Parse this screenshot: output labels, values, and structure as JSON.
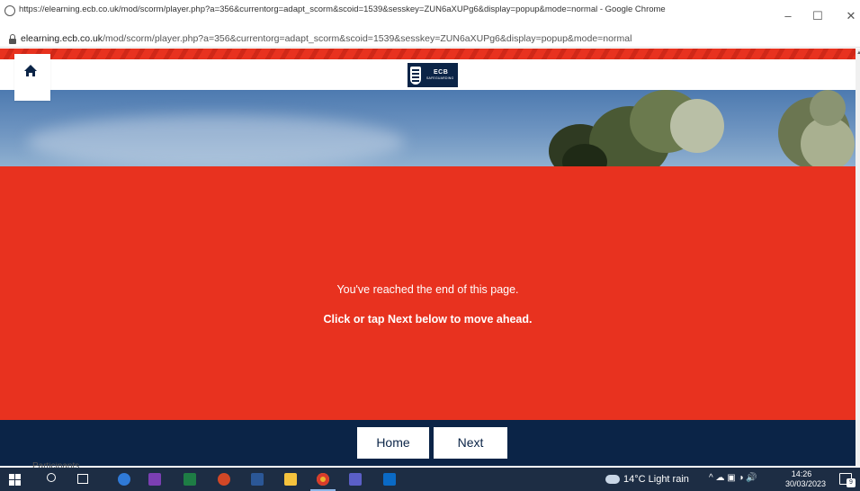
{
  "window": {
    "title": "https://elearning.ecb.co.uk/mod/scorm/player.php?a=356&currentorg=adapt_scorm&scoid=1539&sesskey=ZUN6aXUPg6&display=popup&mode=normal - Google Chrome",
    "minimize_icon": "minimize-icon",
    "maximize_icon": "maximize-icon",
    "close_icon": "close-icon"
  },
  "urlbar": {
    "domain": "elearning.ecb.co.uk",
    "path": "/mod/scorm/player.php?a=356&currentorg=adapt_scorm&scoid=1539&sesskey=ZUN6aXUPg6&display=popup&mode=normal"
  },
  "course": {
    "home_icon": "home-icon",
    "logo_main": "ECB",
    "logo_sub": "SAFEGUARDING",
    "end_message": "You've reached the end of this page.",
    "cta_message": "Click or tap Next below to move ahead."
  },
  "footer": {
    "home_label": "Home",
    "next_label": "Next"
  },
  "background_page": {
    "participants": "Participants"
  },
  "taskbar": {
    "weather": "14°C  Light rain",
    "tray": "^",
    "time": "14:26",
    "date": "30/03/2023",
    "notification_count": "9"
  },
  "colors": {
    "accent_red": "#e8321f",
    "navy": "#0b2447",
    "taskbar": "#1d2d44"
  }
}
